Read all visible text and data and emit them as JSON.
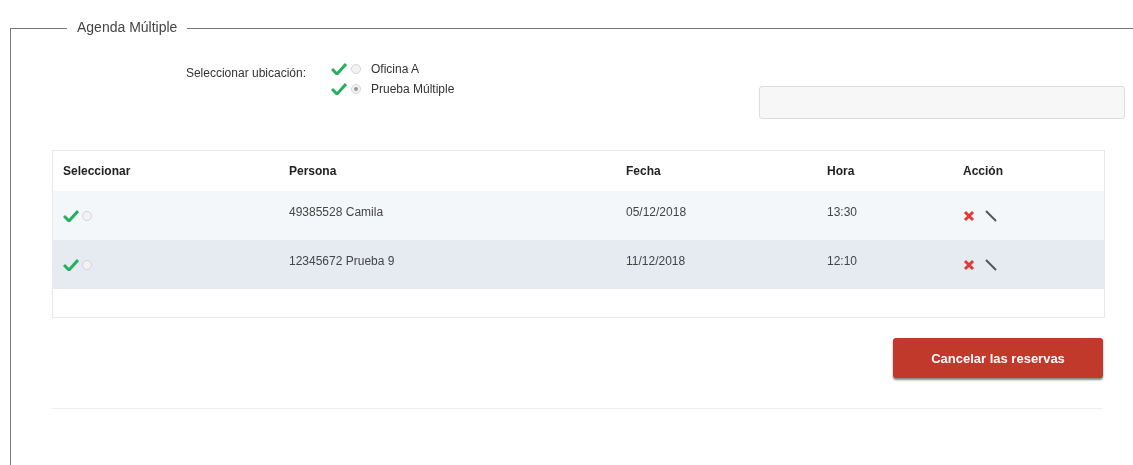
{
  "fieldset": {
    "legend": "Agenda Múltiple"
  },
  "location": {
    "label": "Seleccionar ubicación:",
    "options": [
      {
        "label": "Oficina A",
        "selected": false
      },
      {
        "label": "Prueba Múltiple",
        "selected": true
      }
    ]
  },
  "table": {
    "columns": [
      "Seleccionar",
      "Persona",
      "Fecha",
      "Hora",
      "Acción"
    ],
    "rows": [
      {
        "selected": false,
        "highlighted": false,
        "persona": "49385528 Camila",
        "fecha": "05/12/2018",
        "hora": "13:30"
      },
      {
        "selected": false,
        "highlighted": true,
        "persona": "12345672 Prueba 9",
        "fecha": "11/12/2018",
        "hora": "12:10"
      }
    ]
  },
  "buttons": [
    {
      "label": "Cancelar las reservas",
      "kind": "danger"
    }
  ]
}
